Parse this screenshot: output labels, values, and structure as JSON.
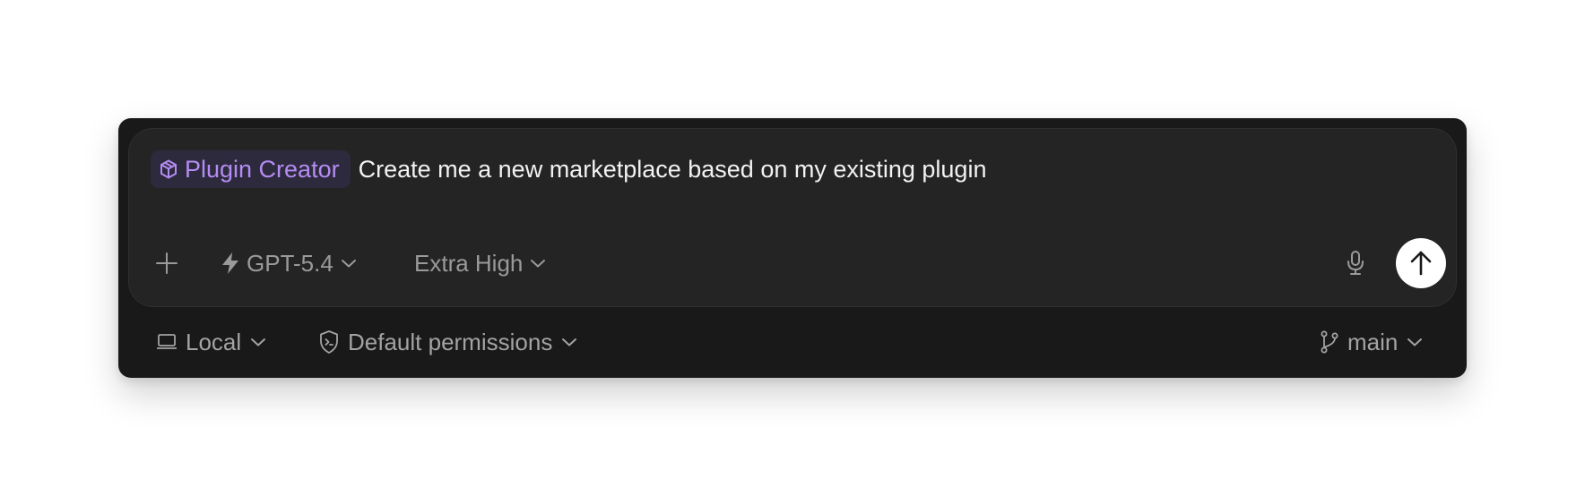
{
  "composer": {
    "mention_chip": {
      "label": "Plugin Creator",
      "icon": "package-icon",
      "text_color": "#b48cf2",
      "background": "#2e2a3d"
    },
    "prompt_text": "Create me a new marketplace based on my existing plugin",
    "toolbar": {
      "add_icon": "plus-icon",
      "model": {
        "icon": "bolt-icon",
        "label": "GPT-5.4"
      },
      "reasoning": {
        "label": "Extra High"
      },
      "mic_icon": "microphone-icon",
      "send_icon": "arrow-up-icon"
    }
  },
  "footer": {
    "environment": {
      "icon": "laptop-icon",
      "label": "Local"
    },
    "permissions": {
      "icon": "shield-terminal-icon",
      "label": "Default permissions"
    },
    "branch": {
      "icon": "git-branch-icon",
      "label": "main"
    }
  },
  "colors": {
    "frame": "#191919",
    "card": "#242424",
    "muted_text": "#9a9a9a",
    "primary_text": "#f2f2f2",
    "accent": "#b48cf2"
  }
}
